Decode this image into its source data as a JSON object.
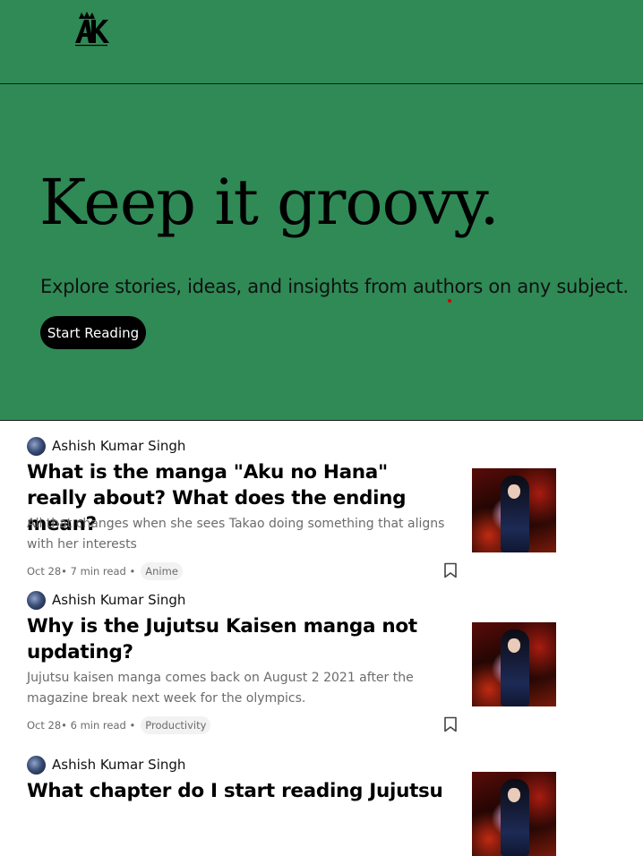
{
  "header": {
    "logo_icon": "ak-crown-logo"
  },
  "hero": {
    "title": "Keep it groovy.",
    "subtitle": "Explore stories, ideas, and insights from authors on any subject.",
    "cta_label": "Start Reading",
    "background_color": "#2f8a56"
  },
  "articles": [
    {
      "author": "Ashish Kumar Singh",
      "title": "What is the manga \"Aku no Hana\" really about? What does the ending mean?",
      "excerpt": "All that changes when she sees Takao doing something that aligns with her interests",
      "meta": "Oct 28• 7 min read •",
      "tag": "Anime",
      "thumbnail": "anime-character-thumbnail"
    },
    {
      "author": "Ashish Kumar Singh",
      "title": "Why is the Jujutsu Kaisen manga not updating?",
      "excerpt": "Jujutsu kaisen manga comes back on August 2 2021 after the magazine break next week for the olympics.",
      "meta": "Oct 28• 6 min read •",
      "tag": "Productivity",
      "thumbnail": "anime-character-thumbnail"
    },
    {
      "author": "Ashish Kumar Singh",
      "title": "What chapter do I start reading Jujutsu",
      "thumbnail": "anime-character-thumbnail"
    }
  ]
}
